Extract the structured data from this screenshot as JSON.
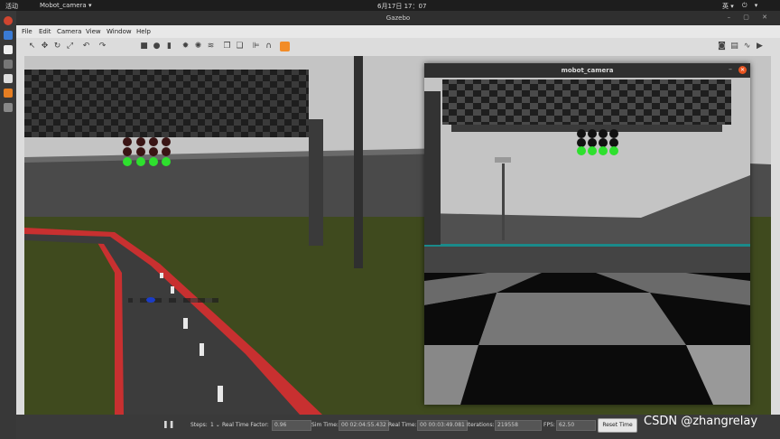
{
  "topbar": {
    "activities": "活动",
    "app_menu": "Mobot_camera ▾",
    "clock": "6月17日 17：07",
    "ime": "英 ▾",
    "system_icons": "⏻ ▾"
  },
  "window": {
    "title": "Gazebo",
    "controls": "– ▢ ✕"
  },
  "menubar": {
    "items": [
      "File",
      "Edit",
      "Camera",
      "View",
      "Window",
      "Help"
    ]
  },
  "camera_window": {
    "title": "mobot_camera",
    "minimize": "–",
    "close": "✕"
  },
  "statusbar": {
    "pause_icon": "❚❚",
    "steps_label": "Steps:",
    "steps_value": "1 ⌄",
    "rtf_label": "Real Time Factor:",
    "rtf_value": "0.96",
    "sim_time_label": "Sim Time:",
    "sim_time_value": "00 02:04:55.432",
    "real_time_label": "Real Time:",
    "real_time_value": "00 00:03:49.081",
    "iterations_label": "Iterations:",
    "iterations_value": "219558",
    "fps_label": "FPS:",
    "fps_value": "62.50",
    "reset_button": "Reset Time"
  },
  "watermark": "CSDN @zhangrelay",
  "colors": {
    "traffic_light_green": "#2ee02e",
    "traffic_light_off": "#3a1414",
    "grass": "#3f4a1e",
    "sky": "#c8c8c8",
    "close_button": "#e95420"
  }
}
